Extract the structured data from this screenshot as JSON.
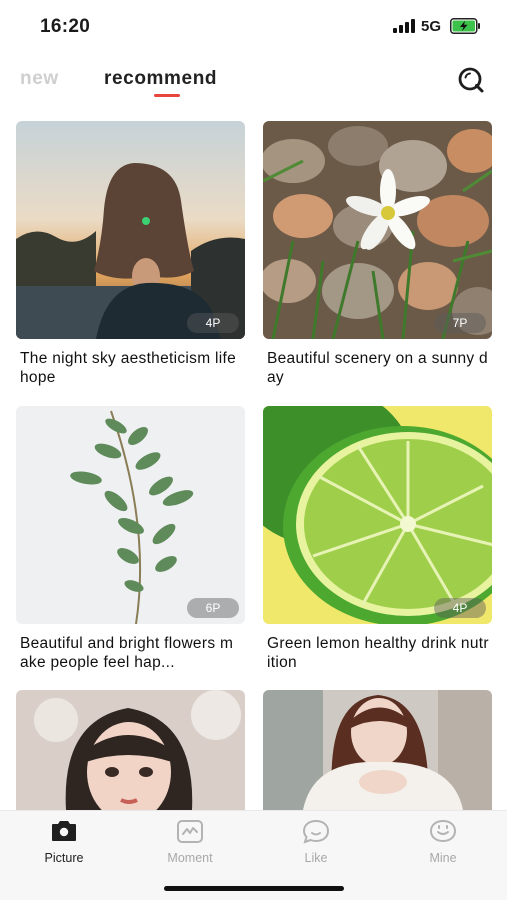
{
  "status_bar": {
    "time": "16:20",
    "network": "5G",
    "battery_icon": "battery-charging-icon",
    "signal_icon": "cellular-signal-icon"
  },
  "top_tabs": {
    "tabs": [
      {
        "label": "new",
        "active": false
      },
      {
        "label": "recommend",
        "active": true
      }
    ],
    "search_icon": "search-icon",
    "accent_color": "#e8453c"
  },
  "feed": {
    "items": [
      {
        "title": "The night sky aestheticism life hope",
        "count": "4P",
        "image": "girl silhouette at sunset by water"
      },
      {
        "title": "Beautiful scenery on a sunny day",
        "count": "7P",
        "image": "white flower among pebbles and grass"
      },
      {
        "title": "Beautiful and bright flowers make people feel hap...",
        "count": "6P",
        "image": "eucalyptus branch on white"
      },
      {
        "title": "Green lemon healthy drink nutrition",
        "count": "4P",
        "image": "lime slice on yellow background"
      },
      {
        "title": "",
        "count": "",
        "image": "girl portrait with bangs and flowers"
      },
      {
        "title": "",
        "count": "",
        "image": "girl in white sweater by window"
      }
    ]
  },
  "bottom_nav": {
    "items": [
      {
        "label": "Picture",
        "icon": "picture-icon",
        "active": true
      },
      {
        "label": "Moment",
        "icon": "moment-icon",
        "active": false
      },
      {
        "label": "Like",
        "icon": "like-icon",
        "active": false
      },
      {
        "label": "Mine",
        "icon": "mine-icon",
        "active": false
      }
    ]
  }
}
